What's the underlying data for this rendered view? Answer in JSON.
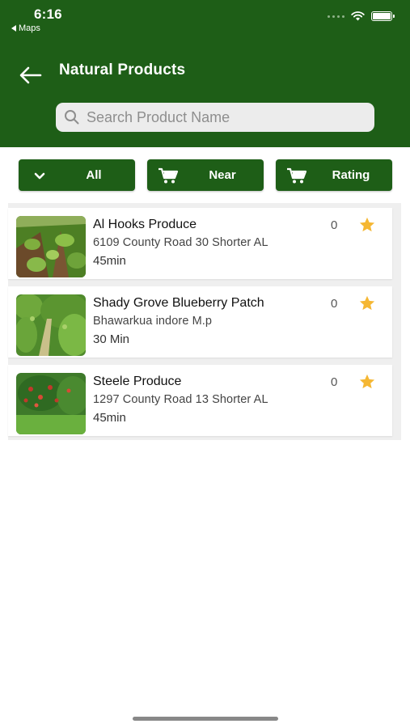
{
  "status_bar": {
    "time": "6:16",
    "back_app": "Maps"
  },
  "header": {
    "title": "Natural Products"
  },
  "search": {
    "placeholder": "Search Product Name",
    "value": ""
  },
  "filters": [
    {
      "label": "All",
      "icon": "chevron-down-icon"
    },
    {
      "label": "Near",
      "icon": "cart-icon"
    },
    {
      "label": "Rating",
      "icon": "cart-icon"
    }
  ],
  "colors": {
    "brand": "#1e5e17",
    "star": "#f5b733"
  },
  "products": [
    {
      "name": "Al Hooks Produce",
      "address": "6109 County Road 30 Shorter AL",
      "time": "45min",
      "rating_count": "0",
      "icon": "star-icon"
    },
    {
      "name": "Shady Grove Blueberry Patch",
      "address": "Bhawarkua indore M.p",
      "time": "30 Min",
      "rating_count": "0",
      "icon": "star-icon"
    },
    {
      "name": "Steele Produce",
      "address": "1297 County Road 13 Shorter AL",
      "time": "45min",
      "rating_count": "0",
      "icon": "star-icon"
    }
  ]
}
